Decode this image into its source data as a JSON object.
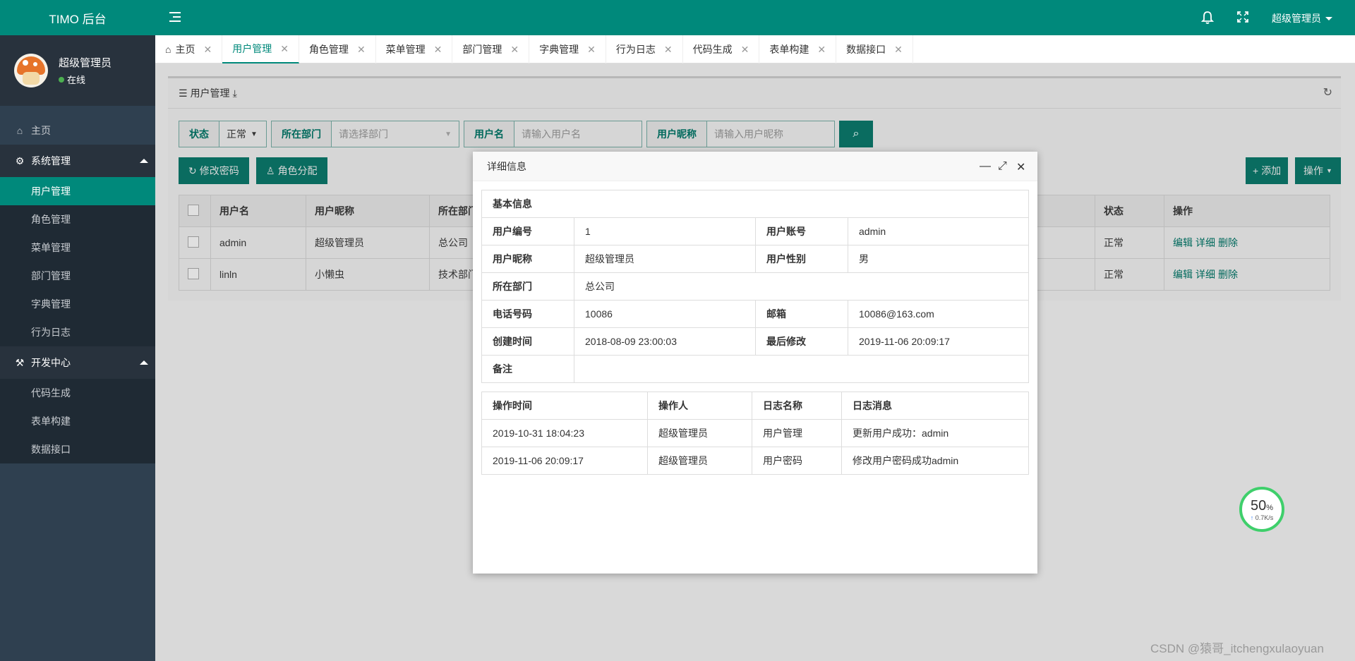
{
  "app": {
    "title": "TIMO 后台"
  },
  "user": {
    "name": "超级管理员",
    "status": "在线"
  },
  "topbar": {
    "user_label": "超级管理员"
  },
  "sidebar": {
    "home": "主页",
    "group1": {
      "label": "系统管理",
      "items": [
        "用户管理",
        "角色管理",
        "菜单管理",
        "部门管理",
        "字典管理",
        "行为日志"
      ]
    },
    "group2": {
      "label": "开发中心",
      "items": [
        "代码生成",
        "表单构建",
        "数据接口"
      ]
    }
  },
  "tabs": [
    "主页",
    "用户管理",
    "角色管理",
    "菜单管理",
    "部门管理",
    "字典管理",
    "行为日志",
    "代码生成",
    "表单构建",
    "数据接口"
  ],
  "panel": {
    "title": "用户管理",
    "filters": {
      "status_label": "状态",
      "status_value": "正常",
      "dept_label": "所在部门",
      "dept_placeholder": "请选择部门",
      "username_label": "用户名",
      "username_placeholder": "请输入用户名",
      "nickname_label": "用户昵称",
      "nickname_placeholder": "请输入用户昵称"
    },
    "buttons": {
      "change_pwd": "修改密码",
      "assign_role": "角色分配",
      "add": "添加",
      "ops": "操作"
    },
    "table": {
      "headers": [
        "用户名",
        "用户昵称",
        "所在部门",
        "状态",
        "操作"
      ],
      "rows": [
        {
          "username": "admin",
          "nickname": "超级管理员",
          "dept": "总公司",
          "status": "正常"
        },
        {
          "username": "linln",
          "nickname": "小懒虫",
          "dept": "技术部门",
          "status": "正常"
        }
      ],
      "ops": [
        "编辑",
        "详细",
        "删除"
      ]
    }
  },
  "modal": {
    "title": "详细信息",
    "section": "基本信息",
    "fields": {
      "id_label": "用户编号",
      "id_value": "1",
      "account_label": "用户账号",
      "account_value": "admin",
      "nick_label": "用户昵称",
      "nick_value": "超级管理员",
      "gender_label": "用户性别",
      "gender_value": "男",
      "dept_label": "所在部门",
      "dept_value": "总公司",
      "phone_label": "电话号码",
      "phone_value": "10086",
      "email_label": "邮箱",
      "email_value": "10086@163.com",
      "created_label": "创建时间",
      "created_value": "2018-08-09 23:00:03",
      "modified_label": "最后修改",
      "modified_value": "2019-11-06 20:09:17",
      "remark_label": "备注",
      "remark_value": ""
    },
    "log": {
      "headers": [
        "操作时间",
        "操作人",
        "日志名称",
        "日志消息"
      ],
      "rows": [
        {
          "time": "2019-10-31 18:04:23",
          "user": "超级管理员",
          "name": "用户管理",
          "msg": "更新用户成功：admin"
        },
        {
          "time": "2019-11-06 20:09:17",
          "user": "超级管理员",
          "name": "用户密码",
          "msg": "修改用户密码成功admin"
        }
      ]
    }
  },
  "speed": {
    "percent": "50",
    "unit": "%",
    "rate": "0.7K/s"
  },
  "watermark": "CSDN @猿哥_itchengxulaoyuan",
  "colors": {
    "brand": "#00897b",
    "sidebar": "#2f4050"
  }
}
